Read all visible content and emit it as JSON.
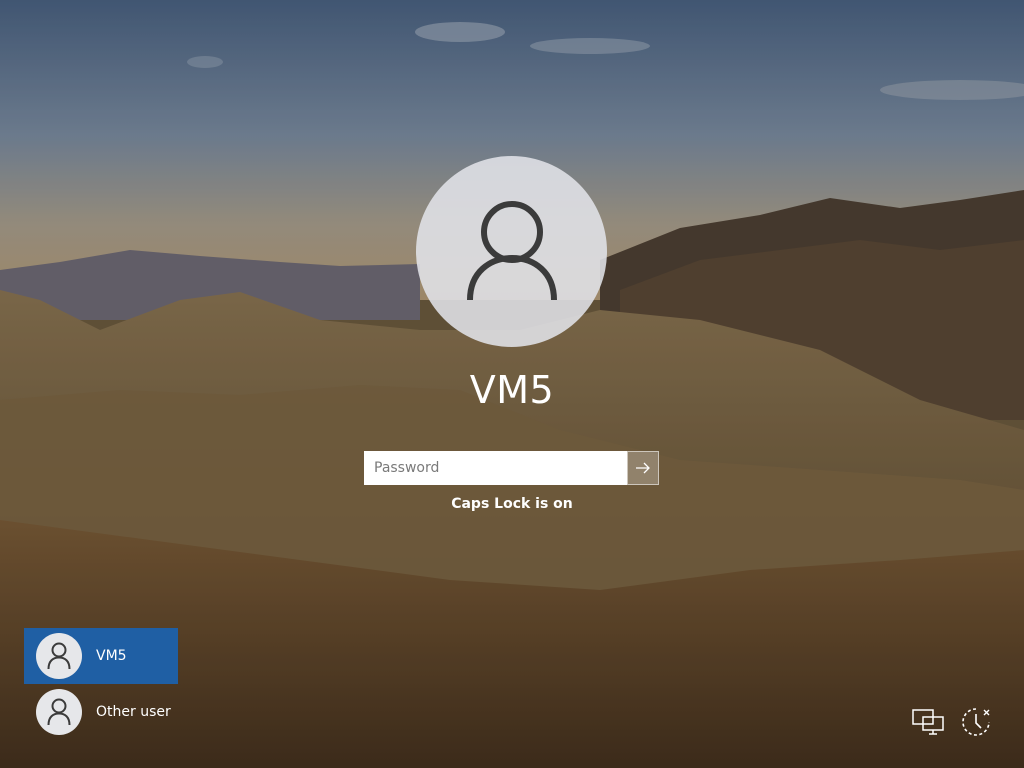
{
  "login": {
    "username": "VM5",
    "password_placeholder": "Password",
    "password_value": "",
    "submit_icon": "arrow-right-icon",
    "caps_lock_message": "Caps Lock is on"
  },
  "user_list": [
    {
      "name": "VM5",
      "selected": true,
      "icon": "user-icon"
    },
    {
      "name": "Other user",
      "selected": false,
      "icon": "user-icon"
    }
  ],
  "system_tray": {
    "network_icon": "network-icon",
    "accessibility_icon": "ease-of-access-icon"
  },
  "colors": {
    "selected_user_bg": "#1f5fa4",
    "text": "#ffffff"
  }
}
